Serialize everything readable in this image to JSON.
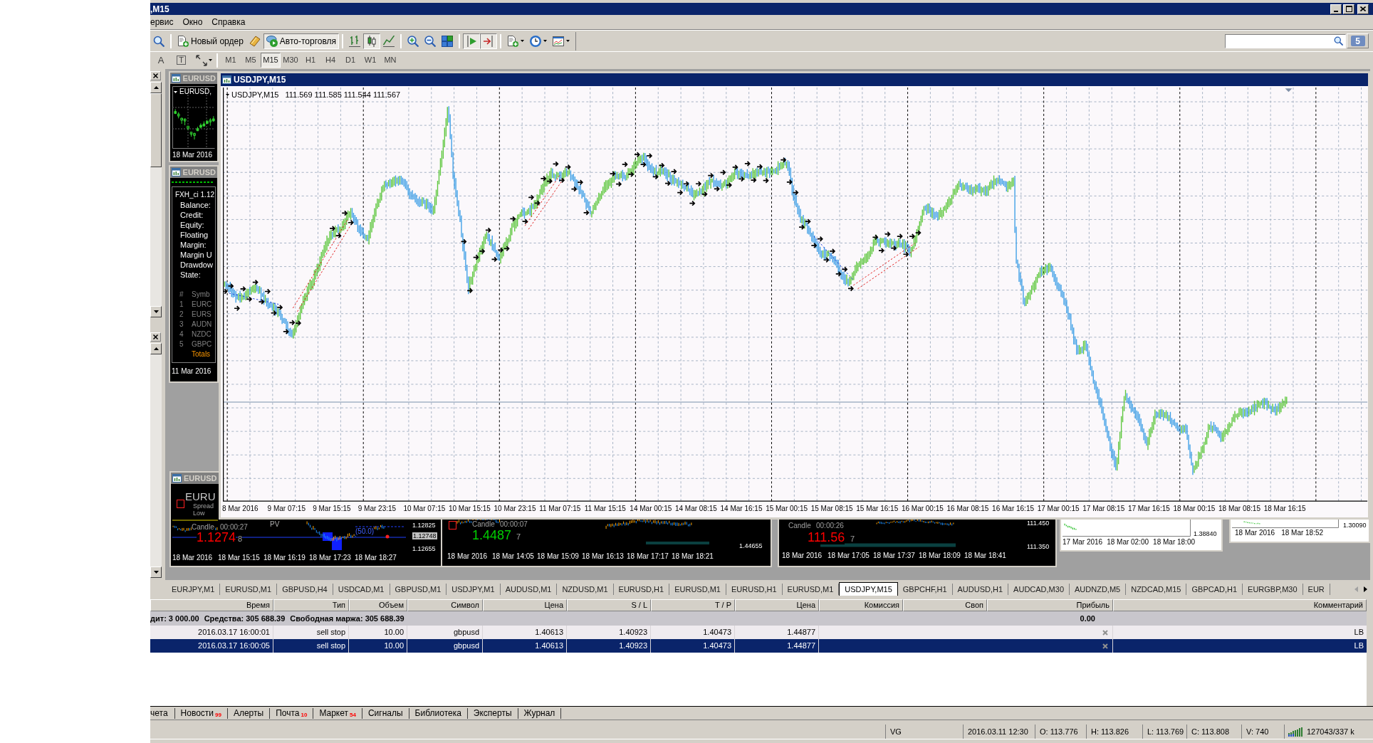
{
  "window": {
    "title": ",M15"
  },
  "menu": [
    "ервис",
    "Окно",
    "Справка"
  ],
  "toolbar": [
    [
      {
        "kind": "find",
        "pressed": false
      }
    ],
    [
      {
        "kind": "new-order",
        "label": "Новый ордер",
        "pressed": false
      },
      {
        "kind": "editor",
        "pressed": false
      },
      {
        "kind": "auto-trading",
        "label": "Авто-торговля",
        "pressed": true
      }
    ],
    [
      {
        "kind": "bars",
        "pressed": false
      },
      {
        "kind": "candles",
        "pressed": true
      },
      {
        "kind": "line",
        "pressed": false
      }
    ],
    [
      {
        "kind": "zoom-in",
        "pressed": false
      },
      {
        "kind": "zoom-out",
        "pressed": false
      },
      {
        "kind": "tile",
        "pressed": false
      }
    ],
    [
      {
        "kind": "autoscroll",
        "pressed": true
      },
      {
        "kind": "chart-shift",
        "pressed": true
      }
    ],
    [
      {
        "kind": "indicators",
        "pressed": false
      },
      {
        "kind": "periods",
        "pressed": false
      },
      {
        "kind": "templates",
        "pressed": false
      }
    ]
  ],
  "messages": {
    "count": "5"
  },
  "drawing_tools": [
    {
      "kind": "plain",
      "glyph": "A"
    },
    {
      "kind": "framed",
      "glyph": "T"
    }
  ],
  "periods": [
    {
      "label": "M1",
      "selected": false
    },
    {
      "label": "M5",
      "selected": false
    },
    {
      "label": "M15",
      "selected": true
    },
    {
      "label": "M30",
      "selected": false
    },
    {
      "label": "H1",
      "selected": false
    },
    {
      "label": "H4",
      "selected": false
    },
    {
      "label": "D1",
      "selected": false
    },
    {
      "label": "W1",
      "selected": false
    },
    {
      "label": "MN",
      "selected": false
    }
  ],
  "windows": [
    {
      "kind": "mini",
      "active": false,
      "title": "EURUSD",
      "header": "EURUSD,",
      "date": "18 Mar 2016"
    },
    {
      "kind": "chart",
      "active": true,
      "title": "USDJPY,M15",
      "header": "USDJPY,M15",
      "quote": "111.569 111.585 111.544 111.567",
      "dates": [
        "8 Mar 2016",
        "9 Mar 07:15",
        "9 Mar 15:15",
        "9 Mar 23:15",
        "10 Mar 07:15",
        "10 Mar 15:15",
        "10 Mar 23:15",
        "11 Mar 07:15",
        "11 Mar 15:15",
        "14 Mar 00:15",
        "14 Mar 08:15",
        "14 Mar 16:15",
        "15 Mar 00:15",
        "15 Mar 08:15",
        "15 Mar 16:15",
        "16 Mar 00:15",
        "16 Mar 08:15",
        "16 Mar 16:15",
        "17 Mar 00:15",
        "17 Mar 08:15",
        "17 Mar 16:15",
        "18 Mar 00:15",
        "18 Mar 08:15",
        "18 Mar 16:15"
      ]
    },
    {
      "kind": "panel",
      "active": false,
      "title": "EURUSD",
      "panel_title": "FXH_ci 1.12",
      "fields": [
        "Balance:",
        "Credit:",
        "Equity:",
        "Floating",
        "Margin:",
        "Margin U",
        "Drawdow",
        "State:"
      ],
      "columns": [
        "#",
        "Symb"
      ],
      "rows": [
        [
          "1",
          "EURC"
        ],
        [
          "2",
          "EURS"
        ],
        [
          "3",
          "AUDN"
        ],
        [
          "4",
          "NZDC"
        ],
        [
          "5",
          "GBPC"
        ]
      ],
      "totals": "Totals",
      "date": "11 Mar 2016"
    },
    {
      "kind": "ticker",
      "active": false,
      "title": "EURUSD",
      "symbol": "EURU",
      "labels": [
        "Spread",
        "Low"
      ],
      "candle": "Candle",
      "timer": "00:00:27",
      "tag": "PV",
      "note": "(50.0)",
      "price": "1.1274",
      "last_digit": "8",
      "color": "#ff0000",
      "scale": [
        {
          "text": "1.12825",
          "current": false
        },
        {
          "text": "1.12748",
          "current": true
        },
        {
          "text": "1.12655",
          "current": false
        }
      ],
      "dates": [
        "18 Mar 2016",
        "18 Mar 15:15",
        "18 Mar 16:19",
        "18 Mar 17:23",
        "18 Mar 18:27"
      ]
    },
    {
      "kind": "ticker",
      "candle": "Candle",
      "timer": "00:00:07",
      "price": "1.4487",
      "last_digit": "7",
      "color": "#00d000",
      "scale": [
        {
          "text": "1.44655",
          "current": false
        }
      ],
      "dates": [
        "18 Mar 2016",
        "18 Mar 14:05",
        "18 Mar 15:09",
        "18 Mar 16:13",
        "18 Mar 17:17",
        "18 Mar 18:21"
      ]
    },
    {
      "kind": "ticker",
      "candle": "Candle",
      "timer": "00:00:26",
      "price": "111.56",
      "last_digit": "7",
      "color": "#ff0000",
      "scale": [
        {
          "text": "111.450",
          "current": false
        },
        {
          "text": "111.350",
          "current": false
        }
      ],
      "dates": [
        "18 Mar 2016",
        "18 Mar 17:05",
        "18 Mar 17:37",
        "18 Mar 18:09",
        "18 Mar 18:41"
      ]
    },
    {
      "kind": "strip",
      "scale": [
        {
          "text": "1.38840",
          "current": false
        }
      ],
      "dates": [
        "17 Mar 2016",
        "18 Mar 02:00",
        "18 Mar 18:00"
      ]
    },
    {
      "kind": "strip",
      "scale": [
        {
          "text": "1.30090",
          "current": false
        }
      ],
      "dates": [
        "18 Mar 2016",
        "18 Mar 18:52"
      ]
    }
  ],
  "chart_tabs": [
    {
      "label": "EURJPY,M1",
      "selected": false
    },
    {
      "label": "EURUSD,M1",
      "selected": false
    },
    {
      "label": "GBPUSD,H4",
      "selected": false
    },
    {
      "label": "USDCAD,M1",
      "selected": false
    },
    {
      "label": "GBPUSD,M1",
      "selected": false
    },
    {
      "label": "USDJPY,M1",
      "selected": false
    },
    {
      "label": "AUDUSD,M1",
      "selected": false
    },
    {
      "label": "NZDUSD,M1",
      "selected": false
    },
    {
      "label": "EURUSD,H1",
      "selected": false
    },
    {
      "label": "EURUSD,M1",
      "selected": false
    },
    {
      "label": "EURUSD,H1",
      "selected": false
    },
    {
      "label": "EURUSD,M1",
      "selected": false
    },
    {
      "label": "USDJPY,M15",
      "selected": true
    },
    {
      "label": "GBPCHF,H1",
      "selected": false
    },
    {
      "label": "AUDUSD,H1",
      "selected": false
    },
    {
      "label": "AUDCAD,M30",
      "selected": false
    },
    {
      "label": "AUDNZD,M5",
      "selected": false
    },
    {
      "label": "NZDCAD,M15",
      "selected": false
    },
    {
      "label": "GBPCAD,H1",
      "selected": false
    },
    {
      "label": "EURGBP,M30",
      "selected": false
    },
    {
      "label": "EUR",
      "selected": false
    }
  ],
  "orders": {
    "columns": [
      "Время",
      "Тип",
      "Объем",
      "Символ",
      "Цена",
      "S / L",
      "T / P",
      "Цена",
      "Комиссия",
      "Своп",
      "Прибыль",
      "Комментарий"
    ],
    "summary": [
      "дит: 3 000.00",
      "Средства: 305 688.39",
      "Свободная маржа: 305 688.39"
    ],
    "summary_profit": "0.00",
    "rows": [
      {
        "selected": false,
        "cells": [
          "2016.03.17 16:00:01",
          "sell stop",
          "10.00",
          "gbpusd",
          "1.40613",
          "1.40923",
          "1.40473",
          "1.44877"
        ],
        "comment": "LB"
      },
      {
        "selected": true,
        "cells": [
          "2016.03.17 16:00:05",
          "sell stop",
          "10.00",
          "gbpusd",
          "1.40613",
          "1.40923",
          "1.40473",
          "1.44877"
        ],
        "comment": "LB"
      }
    ]
  },
  "terminal_tabs": [
    {
      "label": "чета"
    },
    {
      "label": "Новости",
      "count": "99"
    },
    {
      "label": "Алерты"
    },
    {
      "label": "Почта",
      "count": "10"
    },
    {
      "label": "Маркет",
      "count": "54"
    },
    {
      "label": "Сигналы"
    },
    {
      "label": "Библиотека"
    },
    {
      "label": "Эксперты"
    },
    {
      "label": "Журнал"
    }
  ],
  "status_bar": {
    "fields": [
      "VG",
      "2016.03.11 12:30",
      "O: 113.776",
      "H: 113.826",
      "L: 113.769",
      "C: 113.808",
      "V: 740"
    ],
    "traffic": "127043/337 k"
  }
}
